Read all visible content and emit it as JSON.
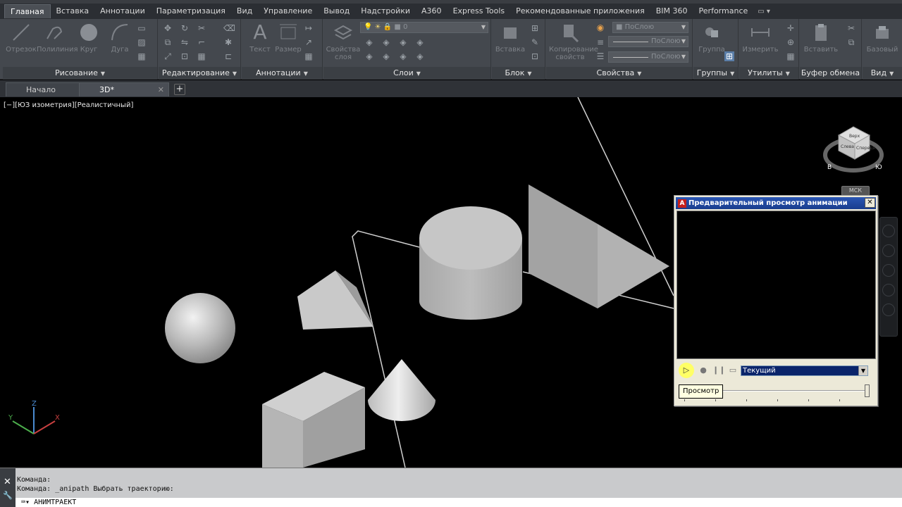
{
  "ribbon_tabs": [
    "Главная",
    "Вставка",
    "Аннотации",
    "Параметризация",
    "Вид",
    "Управление",
    "Вывод",
    "Надстройки",
    "А360",
    "Express Tools",
    "Рекомендованные приложения",
    "BIM 360",
    "Performance"
  ],
  "ribbon_groups": {
    "draw": {
      "title": "Рисование",
      "tools": [
        "Отрезок",
        "Полилиния",
        "Круг",
        "Дуга"
      ]
    },
    "modify": {
      "title": "Редактирование"
    },
    "annotation": {
      "title": "Аннотации",
      "tools": [
        "Текст",
        "Размер"
      ]
    },
    "layers": {
      "title": "Слои",
      "properties_label": "Свойства слоя",
      "layer_value": "0"
    },
    "block": {
      "title": "Блок",
      "tools": [
        "Вставка"
      ]
    },
    "properties": {
      "title": "Свойства",
      "match_label": "Копирование свойств",
      "byLayer": "ПоСлою"
    },
    "groups": {
      "title": "Группы",
      "tools": [
        "Группа"
      ]
    },
    "utilities": {
      "title": "Утилиты",
      "tools": [
        "Измерить"
      ]
    },
    "clipboard": {
      "title": "Буфер обмена",
      "tools": [
        "Вставить"
      ]
    },
    "view": {
      "title": "Вид",
      "tools": [
        "Базовый"
      ]
    }
  },
  "file_tabs": [
    {
      "label": "Начало"
    },
    {
      "label": "3D*"
    }
  ],
  "viewport": {
    "label": "[−][ЮЗ изометрия][Реалистичный]",
    "wcs": "МСК",
    "viewcube": {
      "top": "Верх",
      "left": "Слева",
      "front": "Спереди",
      "south": "Ю",
      "east": "В"
    }
  },
  "anim_dialog": {
    "title": "Предварительный просмотр анимации",
    "close": "✕",
    "select_value": "Текущий",
    "tooltip": "Просмотр"
  },
  "command_line": {
    "history": [
      "Команда:",
      "Команда: _anipath Выбрать траекторию:"
    ],
    "prompt": "АНИМТРАЕКТ"
  },
  "axes": {
    "x": "X",
    "y": "Y",
    "z": "Z"
  }
}
